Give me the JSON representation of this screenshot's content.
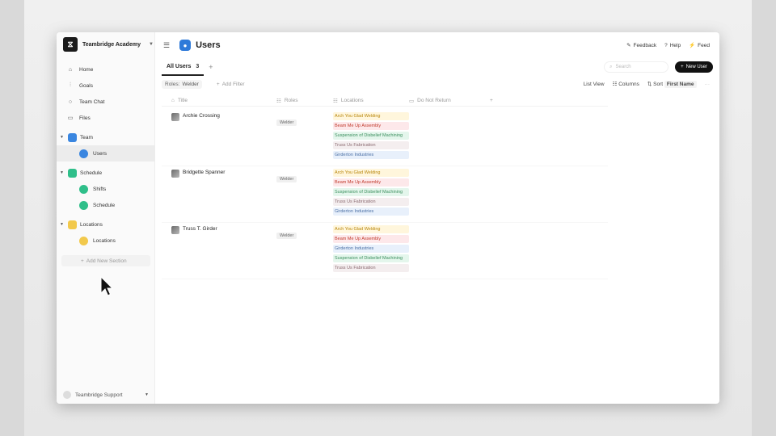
{
  "org": {
    "name": "Teambridge Academy"
  },
  "sidebar": {
    "items": [
      {
        "label": "Home",
        "icon": "home-icon"
      },
      {
        "label": "Goals",
        "icon": "chart-icon"
      },
      {
        "label": "Team Chat",
        "icon": "chat-icon"
      },
      {
        "label": "Files",
        "icon": "file-icon"
      }
    ],
    "groups": [
      {
        "label": "Team",
        "color": "#3a86e0",
        "children": [
          {
            "label": "Users",
            "color": "#3a86e0",
            "active": true
          }
        ]
      },
      {
        "label": "Schedule",
        "color": "#2fbf8a",
        "children": [
          {
            "label": "Shifts",
            "color": "#2fbf8a"
          },
          {
            "label": "Schedule",
            "color": "#2fbf8a"
          }
        ]
      },
      {
        "label": "Locations",
        "color": "#f2c94c",
        "children": [
          {
            "label": "Locations",
            "color": "#f2c94c"
          }
        ]
      }
    ],
    "add_section": "Add New Section",
    "support": "Teambridge Support"
  },
  "header": {
    "title": "Users",
    "feedback": "Feedback",
    "help": "Help",
    "feed": "Feed"
  },
  "tabs": {
    "active_label": "All Users",
    "active_count": "3",
    "search_placeholder": "Search",
    "new_button": "New User"
  },
  "filters": {
    "role_key": "Roles:",
    "role_value": "Welder",
    "add_filter": "Add Filter",
    "list_view": "List View",
    "columns": "Columns",
    "sort": "Sort",
    "sort_value": "First Name"
  },
  "table": {
    "headers": {
      "title": "Title",
      "roles": "Roles",
      "locations": "Locations",
      "dnr": "Do Not Return"
    },
    "rows": [
      {
        "name": "Archie Crossing",
        "role": "Welder",
        "locations": [
          "Arch You Glad Welding",
          "Beam Me Up Assembly",
          "Suspension of Disbelief Machining",
          "Truss Us Fabrication",
          "Girderton Industries"
        ]
      },
      {
        "name": "Bridgette Spanner",
        "role": "Welder",
        "locations": [
          "Arch You Glad Welding",
          "Beam Me Up Assembly",
          "Suspension of Disbelief Machining",
          "Truss Us Fabrication",
          "Girderton Industries"
        ]
      },
      {
        "name": "Truss T. Girder",
        "role": "Welder",
        "locations": [
          "Arch You Glad Welding",
          "Beam Me Up Assembly",
          "Girderton Industries",
          "Suspension of Disbelief Machining",
          "Truss Us Fabrication"
        ]
      }
    ],
    "location_colors": {
      "Arch You Glad Welding": {
        "bg": "#fff6dc",
        "fg": "#b8860b"
      },
      "Beam Me Up Assembly": {
        "bg": "#fde8ea",
        "fg": "#c0392b"
      },
      "Suspension of Disbelief Machining": {
        "bg": "#e4f6ec",
        "fg": "#3b8f5e"
      },
      "Truss Us Fabrication": {
        "bg": "#f4eeef",
        "fg": "#8a6a70"
      },
      "Girderton Industries": {
        "bg": "#e8f0fb",
        "fg": "#4a6fa5"
      }
    }
  }
}
